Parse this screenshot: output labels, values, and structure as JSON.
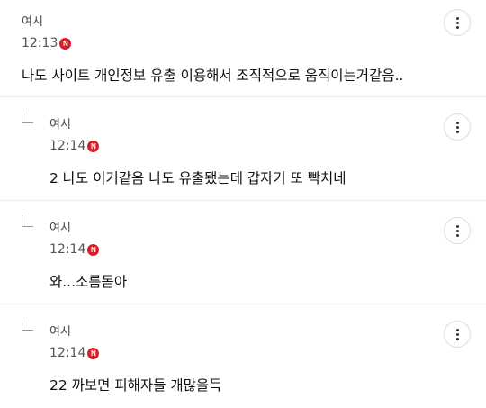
{
  "comments": [
    {
      "author": "여시",
      "time": "12:13",
      "badge": "N",
      "text": "나도 사이트 개인정보 유출 이용해서 조직적으로 움직이는거같음..",
      "is_reply": false
    },
    {
      "author": "여시",
      "time": "12:14",
      "badge": "N",
      "text": "2 나도 이거같음 나도 유출됐는데 갑자기 또 빡치네",
      "is_reply": true
    },
    {
      "author": "여시",
      "time": "12:14",
      "badge": "N",
      "text": "와...소름돋아",
      "is_reply": true
    },
    {
      "author": "여시",
      "time": "12:14",
      "badge": "N",
      "text": "22 까보면 피해자들 개많을득",
      "is_reply": true
    }
  ],
  "icons": {
    "more": "more-vertical-icon",
    "reply": "reply-arrow-icon",
    "new": "new-badge-icon"
  },
  "colors": {
    "badge": "#d61f26",
    "text": "#111111",
    "divider": "#eeeeee"
  }
}
